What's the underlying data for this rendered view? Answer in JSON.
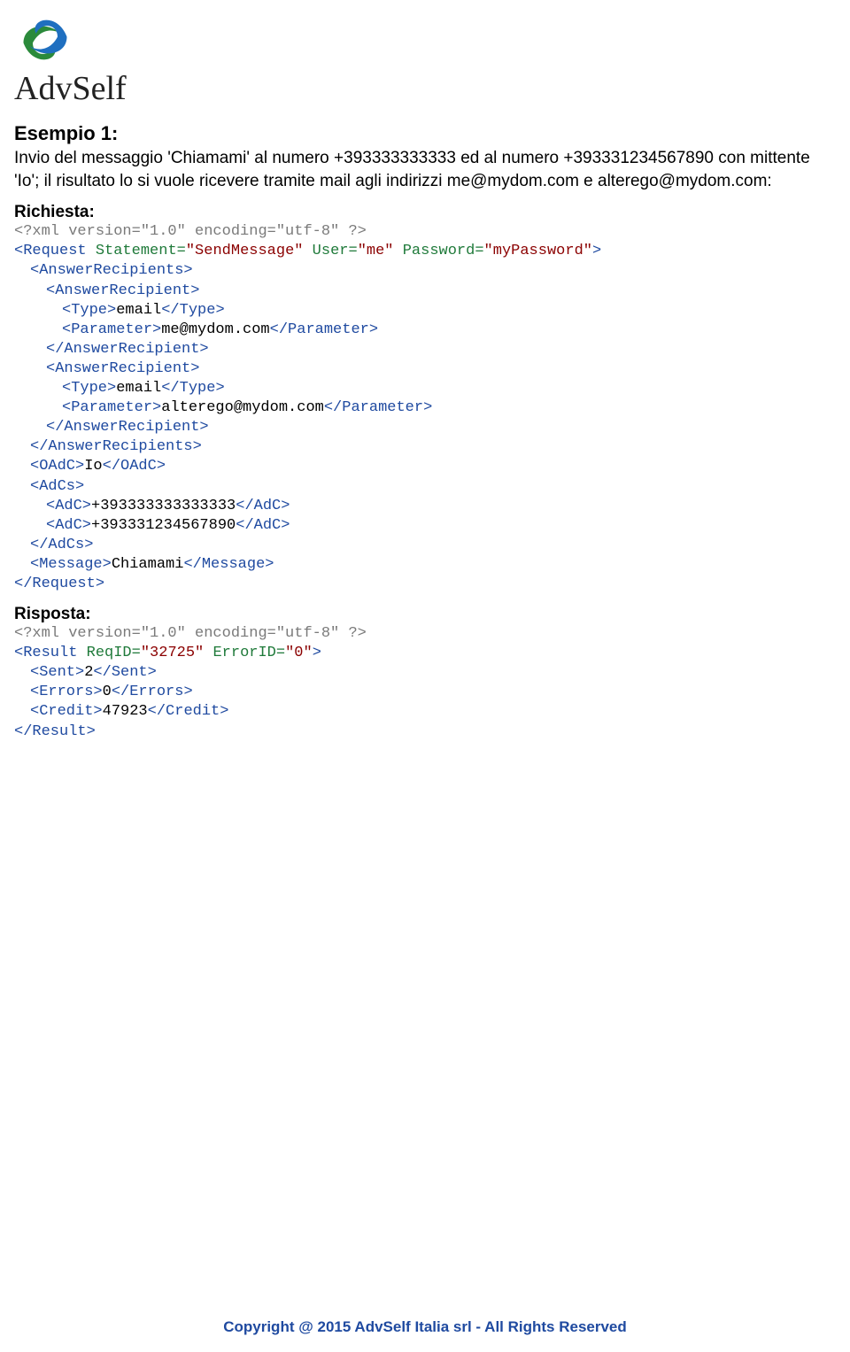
{
  "logo_text": "AdvSelf",
  "heading": "Esempio 1:",
  "intro": "Invio del messaggio 'Chiamami' al numero +393333333333 ed al numero +393331234567890 con mittente 'Io'; il risultato lo si vuole ricevere tramite mail agli indirizzi me@mydom.com e alterego@mydom.com:",
  "request_label": "Richiesta:",
  "response_label": "Risposta:",
  "xml_decl": "<?xml version=\"1.0\" encoding=\"utf-8\" ?>",
  "req": {
    "open_a": "<Request ",
    "attr1_n": "Statement=",
    "attr1_v": "\"SendMessage\"",
    "attr2_n": " User=",
    "attr2_v": "\"me\"",
    "attr3_n": " Password=",
    "attr3_v": "\"myPassword\"",
    "open_b": ">",
    "ar_open": "<AnswerRecipients>",
    "arcp_open": "<AnswerRecipient>",
    "type_open": "<Type>",
    "type_txt": "email",
    "type_close": "</Type>",
    "param_open": "<Parameter>",
    "param1_txt": "me@mydom.com",
    "param2_txt": "alterego@mydom.com",
    "param_close": "</Parameter>",
    "arcp_close": "</AnswerRecipient>",
    "ar_close": "</AnswerRecipients>",
    "oadc_open": "<OAdC>",
    "oadc_txt": "Io",
    "oadc_close": "</OAdC>",
    "adcs_open": "<AdCs>",
    "adc_open": "<AdC>",
    "adc1_txt": "+393333333333333",
    "adc2_txt": "+393331234567890",
    "adc_close": "</AdC>",
    "adcs_close": "</AdCs>",
    "msg_open": "<Message>",
    "msg_txt": "Chiamami",
    "msg_close": "</Message>",
    "close": "</Request>"
  },
  "res": {
    "open_a": "<Result ",
    "attr1_n": "ReqID=",
    "attr1_v": "\"32725\"",
    "attr2_n": " ErrorID=",
    "attr2_v": "\"0\"",
    "open_b": ">",
    "sent_open": "<Sent>",
    "sent_txt": "2",
    "sent_close": "</Sent>",
    "err_open": "<Errors>",
    "err_txt": "0",
    "err_close": "</Errors>",
    "credit_open": "<Credit>",
    "credit_txt": "47923",
    "credit_close": "</Credit>",
    "close": "</Result>"
  },
  "footer": "Copyright @ 2015 AdvSelf Italia srl -  All Rights Reserved"
}
